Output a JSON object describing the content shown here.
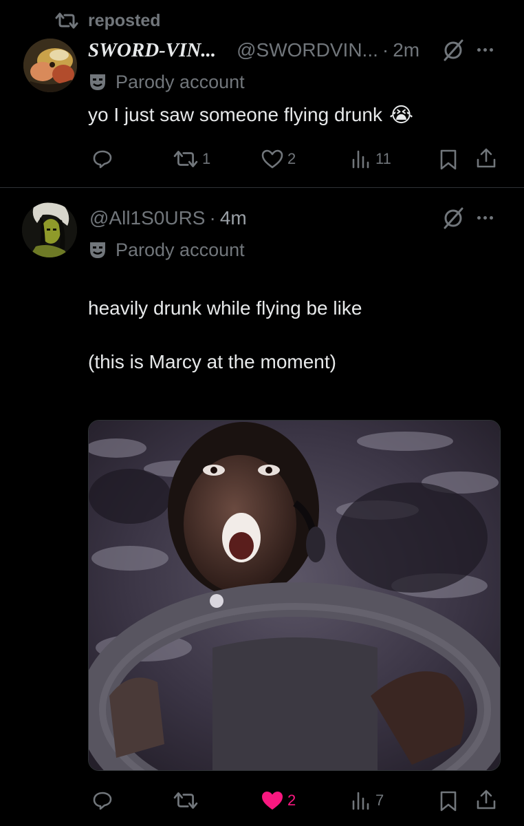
{
  "repost": {
    "label": "reposted"
  },
  "tweet1": {
    "display_name": "SWORD-VIN...",
    "handle": "@SWORDVIN...",
    "time": "2m",
    "parody_label": "Parody account",
    "text": "yo I just saw someone flying drunk",
    "emoji": "😭",
    "actions": {
      "replies": "",
      "reposts": "1",
      "likes": "2",
      "views": "11"
    }
  },
  "tweet2": {
    "handle": "@All1S0URS",
    "time": "4m",
    "parody_label": "Parody account",
    "text_line1": "heavily drunk while flying be like",
    "text_line2": "(this is Marcy at the moment)",
    "actions": {
      "replies": "",
      "reposts": "",
      "likes": "2",
      "views": "7"
    }
  },
  "colors": {
    "background": "#000000",
    "muted": "#71767b",
    "text": "#e7e9ea",
    "like": "#f91880",
    "divider": "#2f3336"
  },
  "icons": [
    "repost-icon",
    "avatar",
    "grok-slash-icon",
    "more-icon",
    "parody-mask-icon",
    "reply-icon",
    "like-icon",
    "views-icon",
    "bookmark-icon",
    "share-icon"
  ]
}
